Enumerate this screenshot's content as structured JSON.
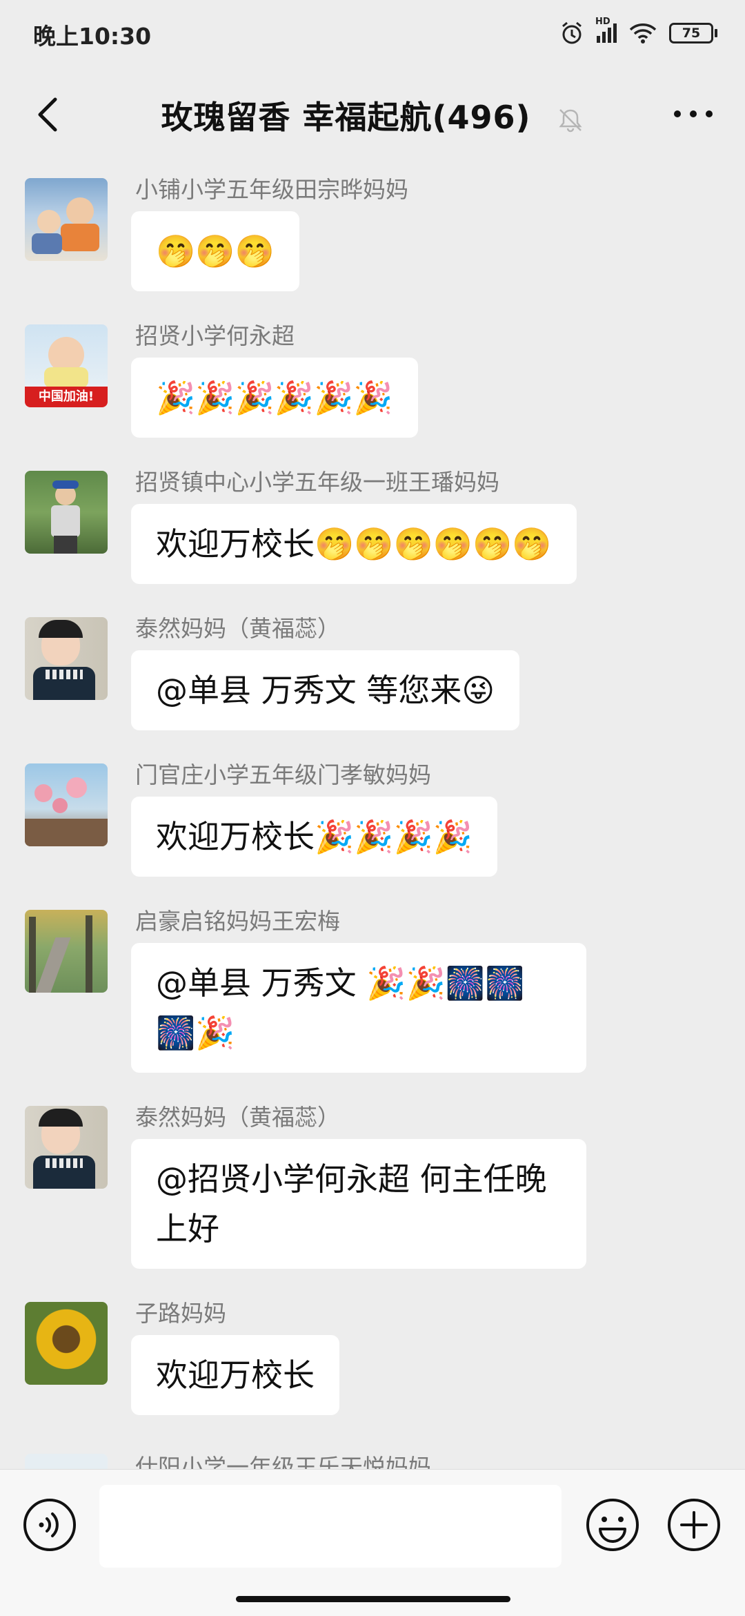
{
  "status_bar": {
    "time": "晚上10:30",
    "battery": "75",
    "network": "HD"
  },
  "header": {
    "title": "玫瑰留香  幸福起航(496)"
  },
  "messages": [
    {
      "sender": "小铺小学五年级田宗晔妈妈",
      "text": "🤭🤭🤭"
    },
    {
      "sender": "招贤小学何永超",
      "text": "🎉🎉🎉🎉🎉🎉",
      "avatar_caption": "中国加油!"
    },
    {
      "sender": "招贤镇中心小学五年级一班王璠妈妈",
      "text": "欢迎万校长🤭🤭🤭🤭🤭🤭"
    },
    {
      "sender": "泰然妈妈（黄福蕊）",
      "text": "@单县 万秀文  等您来😜"
    },
    {
      "sender": "门官庄小学五年级门孝敏妈妈",
      "text": "欢迎万校长🎉🎉🎉🎉"
    },
    {
      "sender": "启豪启铭妈妈王宏梅",
      "text": "@单县 万秀文  🎉🎉🎆🎆🎆🎉"
    },
    {
      "sender": "泰然妈妈（黄福蕊）",
      "text": "@招贤小学何永超  何主任晚上好"
    },
    {
      "sender": "子路妈妈",
      "text": "欢迎万校长"
    }
  ],
  "partial_next": {
    "sender": "仕阳小学一年级王乐天悦妈妈"
  },
  "colors": {
    "background": "#ededed",
    "bubble": "#ffffff",
    "sender": "#7a7a7a"
  }
}
